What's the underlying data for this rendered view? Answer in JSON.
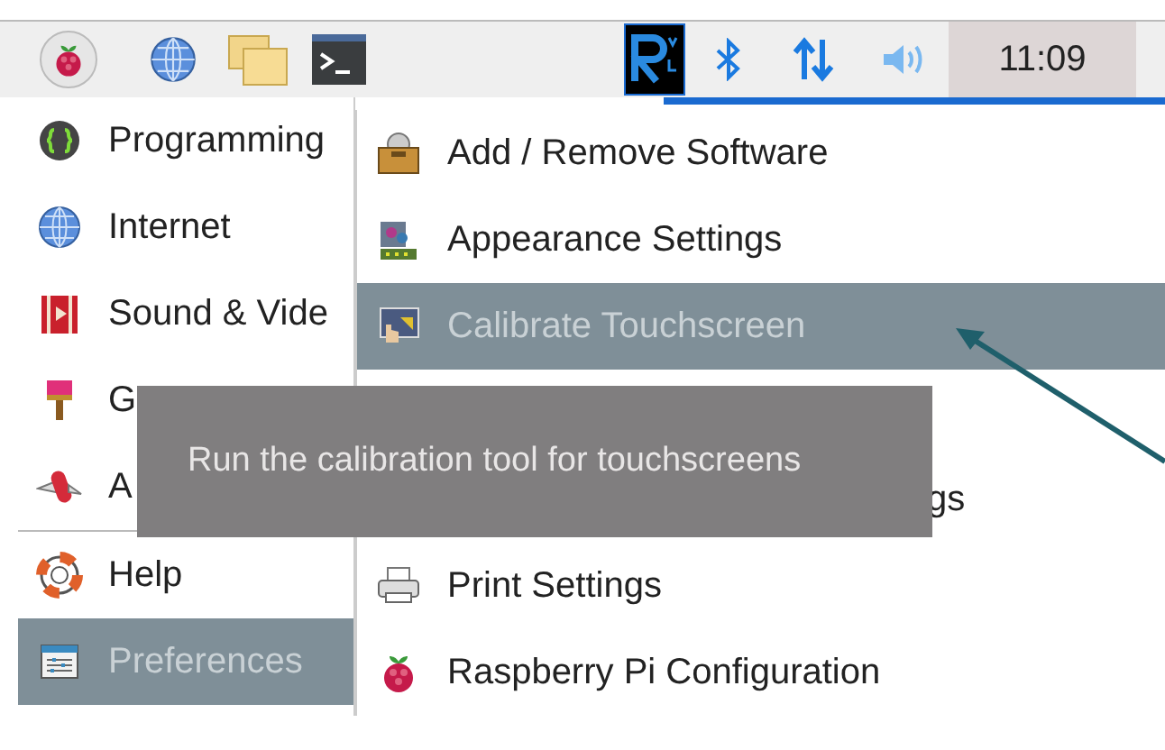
{
  "taskbar": {
    "clock": "11:09"
  },
  "main_menu": [
    {
      "label": "Programming",
      "kind": "braces",
      "selected": false,
      "separator_after": false
    },
    {
      "label": "Internet",
      "kind": "globe",
      "selected": false,
      "separator_after": false
    },
    {
      "label": "Sound & Vide",
      "kind": "film",
      "selected": false,
      "separator_after": false
    },
    {
      "label": "G",
      "kind": "brush",
      "selected": false,
      "separator_after": false
    },
    {
      "label": "A",
      "kind": "knife",
      "selected": false,
      "separator_after": true
    },
    {
      "label": "Help",
      "kind": "lifebuoy",
      "selected": false,
      "separator_after": false
    },
    {
      "label": "Preferences",
      "kind": "prefs",
      "selected": true,
      "separator_after": false
    }
  ],
  "submenu": [
    {
      "label": "Add / Remove Software",
      "kind": "package",
      "selected": false
    },
    {
      "label": "Appearance Settings",
      "kind": "palette",
      "selected": false
    },
    {
      "label": "Calibrate Touchscreen",
      "kind": "touch",
      "selected": true
    },
    {
      "kind": "hidden",
      "selected": false
    },
    {
      "label": "gs",
      "kind": "covered",
      "selected": false
    },
    {
      "label": "Print Settings",
      "kind": "printer",
      "selected": false
    },
    {
      "label": "Raspberry Pi Configuration",
      "kind": "berry",
      "selected": false
    }
  ],
  "tooltip": "Run the calibration tool for touchscreens"
}
